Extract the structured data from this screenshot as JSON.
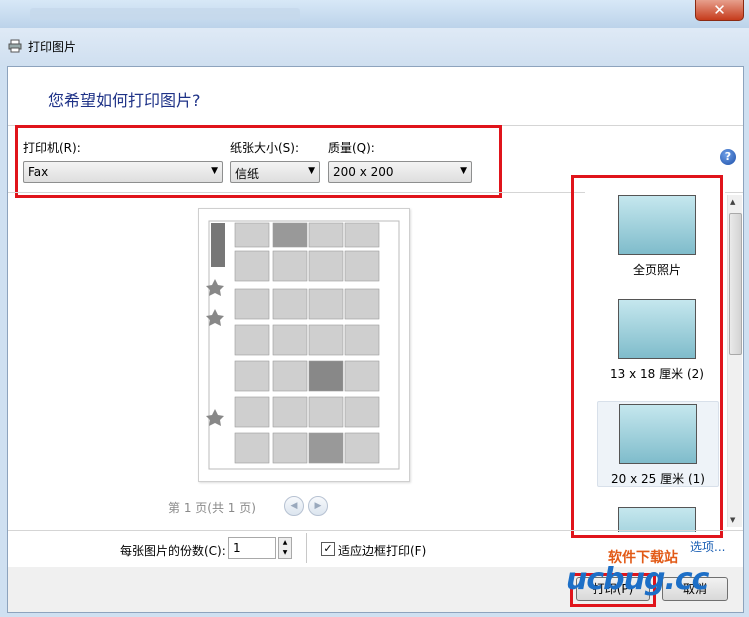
{
  "window": {
    "title": "打印图片",
    "close_glyph": "✕"
  },
  "header": {
    "question": "您希望如何打印图片?"
  },
  "printer": {
    "label": "打印机(R):",
    "value": "Fax"
  },
  "paper": {
    "label": "纸张大小(S):",
    "value": "信纸"
  },
  "quality": {
    "label": "质量(Q):",
    "value": "200 x 200"
  },
  "help": {
    "glyph": "?"
  },
  "preview": {
    "page_info": "第 1 页(共 1 页)",
    "prev_glyph": "◀",
    "next_glyph": "▶"
  },
  "layouts": [
    {
      "label": "全页照片"
    },
    {
      "label": "13 x 18 厘米 (2)"
    },
    {
      "label": "20 x 25 厘米 (1)",
      "selected": true
    },
    {
      "label": ""
    }
  ],
  "options_link": "选项...",
  "copies": {
    "label": "每张图片的份数(C):",
    "value": "1"
  },
  "fit": {
    "label": "适应边框打印(F)",
    "checked": true,
    "check_glyph": "✓"
  },
  "buttons": {
    "print": "打印(P)",
    "cancel": "取消"
  },
  "watermark": {
    "text_top": "软件下载站",
    "text_main": "ucbug.cc"
  },
  "colors": {
    "highlight": "#e0141b",
    "title_text": "#1e3287"
  }
}
